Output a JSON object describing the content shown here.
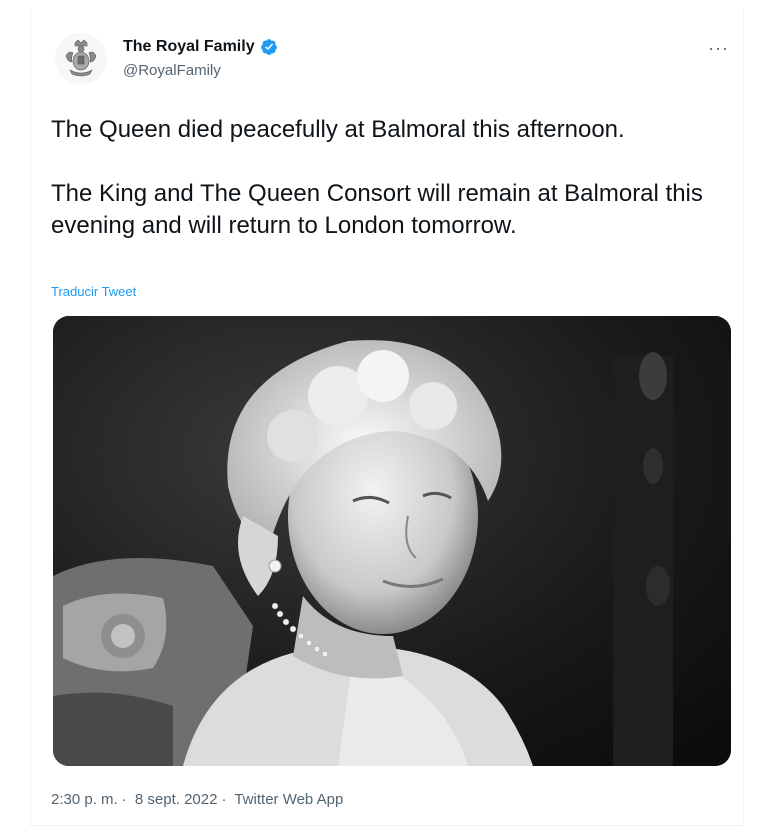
{
  "account": {
    "display_name": "The Royal Family",
    "handle": "@RoyalFamily",
    "verified_icon": "verified-badge-icon",
    "more_icon": "more-options-icon",
    "more_label": "···"
  },
  "tweet": {
    "paragraphs": [
      "The Queen died peacefully at Balmoral this afternoon.",
      "The King and The Queen Consort will remain at Balmoral this evening and will return to London tomorrow."
    ],
    "translate_label": "Traducir Tweet"
  },
  "footer": {
    "time": "2:30 p. m.",
    "date": "8 sept. 2022",
    "source": "Twitter Web App",
    "separator": "·"
  },
  "colors": {
    "accent": "#1d9bf0",
    "text": "#0f1419",
    "muted": "#536471"
  }
}
